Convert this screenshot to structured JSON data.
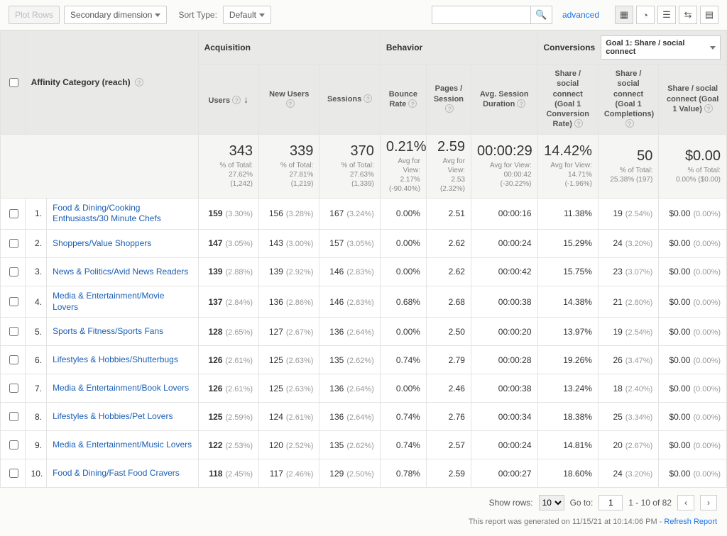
{
  "toolbar": {
    "plot_rows": "Plot Rows",
    "secondary_dim": "Secondary dimension",
    "sort_type_label": "Sort Type:",
    "sort_type_value": "Default",
    "advanced": "advanced"
  },
  "goal_selector": "Goal 1: Share / social connect",
  "groups": {
    "dimension": "Affinity Category (reach)",
    "acquisition": "Acquisition",
    "behavior": "Behavior",
    "conversions": "Conversions"
  },
  "metrics": {
    "users": "Users",
    "new_users": "New Users",
    "sessions": "Sessions",
    "bounce": "Bounce Rate",
    "pps": "Pages / Session",
    "asd": "Avg. Session Duration",
    "g1": "Share / social connect (Goal 1 Conversion Rate)",
    "g2": "Share / social connect (Goal 1 Completions)",
    "g3": "Share / social connect (Goal 1 Value)"
  },
  "summary": {
    "users": {
      "v": "343",
      "s1": "% of Total:",
      "s2": "27.62%",
      "s3": "(1,242)"
    },
    "new_users": {
      "v": "339",
      "s1": "% of Total:",
      "s2": "27.81%",
      "s3": "(1,219)"
    },
    "sessions": {
      "v": "370",
      "s1": "% of Total:",
      "s2": "27.63%",
      "s3": "(1,339)"
    },
    "bounce": {
      "v": "0.21%",
      "s1": "Avg for View:",
      "s2": "2.17%",
      "s3": "(-90.40%)"
    },
    "pps": {
      "v": "2.59",
      "s1": "Avg for View:",
      "s2": "2.53",
      "s3": "(2.32%)"
    },
    "asd": {
      "v": "00:00:29",
      "s1": "Avg for View:",
      "s2": "00:00:42",
      "s3": "(-30.22%)"
    },
    "g1": {
      "v": "14.42%",
      "s1": "Avg for View:",
      "s2": "14.71%",
      "s3": "(-1.96%)"
    },
    "g2": {
      "v": "50",
      "s1": "% of Total:",
      "s2": "25.38% (197)",
      "s3": ""
    },
    "g3": {
      "v": "$0.00",
      "s1": "% of Total:",
      "s2": "0.00% ($0.00)",
      "s3": ""
    }
  },
  "rows": [
    {
      "n": "1.",
      "cat": "Food & Dining/Cooking Enthusiasts/30 Minute Chefs",
      "u": "159",
      "up": "(3.30%)",
      "nu": "156",
      "nup": "(3.28%)",
      "s": "167",
      "sp": "(3.24%)",
      "br": "0.00%",
      "pps": "2.51",
      "asd": "00:00:16",
      "g1": "11.38%",
      "g2": "19",
      "g2p": "(2.54%)",
      "g3": "$0.00",
      "g3p": "(0.00%)"
    },
    {
      "n": "2.",
      "cat": "Shoppers/Value Shoppers",
      "u": "147",
      "up": "(3.05%)",
      "nu": "143",
      "nup": "(3.00%)",
      "s": "157",
      "sp": "(3.05%)",
      "br": "0.00%",
      "pps": "2.62",
      "asd": "00:00:24",
      "g1": "15.29%",
      "g2": "24",
      "g2p": "(3.20%)",
      "g3": "$0.00",
      "g3p": "(0.00%)"
    },
    {
      "n": "3.",
      "cat": "News & Politics/Avid News Readers",
      "u": "139",
      "up": "(2.88%)",
      "nu": "139",
      "nup": "(2.92%)",
      "s": "146",
      "sp": "(2.83%)",
      "br": "0.00%",
      "pps": "2.62",
      "asd": "00:00:42",
      "g1": "15.75%",
      "g2": "23",
      "g2p": "(3.07%)",
      "g3": "$0.00",
      "g3p": "(0.00%)"
    },
    {
      "n": "4.",
      "cat": "Media & Entertainment/Movie Lovers",
      "u": "137",
      "up": "(2.84%)",
      "nu": "136",
      "nup": "(2.86%)",
      "s": "146",
      "sp": "(2.83%)",
      "br": "0.68%",
      "pps": "2.68",
      "asd": "00:00:38",
      "g1": "14.38%",
      "g2": "21",
      "g2p": "(2.80%)",
      "g3": "$0.00",
      "g3p": "(0.00%)"
    },
    {
      "n": "5.",
      "cat": "Sports & Fitness/Sports Fans",
      "u": "128",
      "up": "(2.65%)",
      "nu": "127",
      "nup": "(2.67%)",
      "s": "136",
      "sp": "(2.64%)",
      "br": "0.00%",
      "pps": "2.50",
      "asd": "00:00:20",
      "g1": "13.97%",
      "g2": "19",
      "g2p": "(2.54%)",
      "g3": "$0.00",
      "g3p": "(0.00%)"
    },
    {
      "n": "6.",
      "cat": "Lifestyles & Hobbies/Shutterbugs",
      "u": "126",
      "up": "(2.61%)",
      "nu": "125",
      "nup": "(2.63%)",
      "s": "135",
      "sp": "(2.62%)",
      "br": "0.74%",
      "pps": "2.79",
      "asd": "00:00:28",
      "g1": "19.26%",
      "g2": "26",
      "g2p": "(3.47%)",
      "g3": "$0.00",
      "g3p": "(0.00%)"
    },
    {
      "n": "7.",
      "cat": "Media & Entertainment/Book Lovers",
      "u": "126",
      "up": "(2.61%)",
      "nu": "125",
      "nup": "(2.63%)",
      "s": "136",
      "sp": "(2.64%)",
      "br": "0.00%",
      "pps": "2.46",
      "asd": "00:00:38",
      "g1": "13.24%",
      "g2": "18",
      "g2p": "(2.40%)",
      "g3": "$0.00",
      "g3p": "(0.00%)"
    },
    {
      "n": "8.",
      "cat": "Lifestyles & Hobbies/Pet Lovers",
      "u": "125",
      "up": "(2.59%)",
      "nu": "124",
      "nup": "(2.61%)",
      "s": "136",
      "sp": "(2.64%)",
      "br": "0.74%",
      "pps": "2.76",
      "asd": "00:00:34",
      "g1": "18.38%",
      "g2": "25",
      "g2p": "(3.34%)",
      "g3": "$0.00",
      "g3p": "(0.00%)"
    },
    {
      "n": "9.",
      "cat": "Media & Entertainment/Music Lovers",
      "u": "122",
      "up": "(2.53%)",
      "nu": "120",
      "nup": "(2.52%)",
      "s": "135",
      "sp": "(2.62%)",
      "br": "0.74%",
      "pps": "2.57",
      "asd": "00:00:24",
      "g1": "14.81%",
      "g2": "20",
      "g2p": "(2.67%)",
      "g3": "$0.00",
      "g3p": "(0.00%)"
    },
    {
      "n": "10.",
      "cat": "Food & Dining/Fast Food Cravers",
      "u": "118",
      "up": "(2.45%)",
      "nu": "117",
      "nup": "(2.46%)",
      "s": "129",
      "sp": "(2.50%)",
      "br": "0.78%",
      "pps": "2.59",
      "asd": "00:00:27",
      "g1": "18.60%",
      "g2": "24",
      "g2p": "(3.20%)",
      "g3": "$0.00",
      "g3p": "(0.00%)"
    }
  ],
  "footer": {
    "show_rows": "Show rows:",
    "rows_value": "10",
    "go_to": "Go to:",
    "page_value": "1",
    "range": "1 - 10 of 82"
  },
  "generated": {
    "text": "This report was generated on 11/15/21 at 10:14:06 PM - ",
    "refresh": "Refresh Report"
  },
  "chart_data": {
    "type": "table",
    "title": "Affinity Category (reach)",
    "columns": [
      "Users",
      "New Users",
      "Sessions",
      "Bounce Rate",
      "Pages / Session",
      "Avg. Session Duration",
      "Goal 1 Conversion Rate",
      "Goal 1 Completions",
      "Goal 1 Value"
    ],
    "categories": [
      "Food & Dining/Cooking Enthusiasts/30 Minute Chefs",
      "Shoppers/Value Shoppers",
      "News & Politics/Avid News Readers",
      "Media & Entertainment/Movie Lovers",
      "Sports & Fitness/Sports Fans",
      "Lifestyles & Hobbies/Shutterbugs",
      "Media & Entertainment/Book Lovers",
      "Lifestyles & Hobbies/Pet Lovers",
      "Media & Entertainment/Music Lovers",
      "Food & Dining/Fast Food Cravers"
    ],
    "series": [
      {
        "name": "Users",
        "values": [
          159,
          147,
          139,
          137,
          128,
          126,
          126,
          125,
          122,
          118
        ]
      },
      {
        "name": "New Users",
        "values": [
          156,
          143,
          139,
          136,
          127,
          125,
          125,
          124,
          120,
          117
        ]
      },
      {
        "name": "Sessions",
        "values": [
          167,
          157,
          146,
          146,
          136,
          135,
          136,
          136,
          135,
          129
        ]
      },
      {
        "name": "Bounce Rate %",
        "values": [
          0.0,
          0.0,
          0.0,
          0.68,
          0.0,
          0.74,
          0.0,
          0.74,
          0.74,
          0.78
        ]
      },
      {
        "name": "Pages / Session",
        "values": [
          2.51,
          2.62,
          2.62,
          2.68,
          2.5,
          2.79,
          2.46,
          2.76,
          2.57,
          2.59
        ]
      },
      {
        "name": "Avg Session Duration (s)",
        "values": [
          16,
          24,
          42,
          38,
          20,
          28,
          38,
          34,
          24,
          27
        ]
      },
      {
        "name": "Goal 1 Conversion Rate %",
        "values": [
          11.38,
          15.29,
          15.75,
          14.38,
          13.97,
          19.26,
          13.24,
          18.38,
          14.81,
          18.6
        ]
      },
      {
        "name": "Goal 1 Completions",
        "values": [
          19,
          24,
          23,
          21,
          19,
          26,
          18,
          25,
          20,
          24
        ]
      },
      {
        "name": "Goal 1 Value $",
        "values": [
          0,
          0,
          0,
          0,
          0,
          0,
          0,
          0,
          0,
          0
        ]
      }
    ],
    "totals": {
      "Users": 343,
      "New Users": 339,
      "Sessions": 370,
      "Bounce Rate %": 0.21,
      "Pages / Session": 2.59,
      "Avg Session Duration (s)": 29,
      "Goal 1 Conversion Rate %": 14.42,
      "Goal 1 Completions": 50,
      "Goal 1 Value $": 0
    }
  }
}
